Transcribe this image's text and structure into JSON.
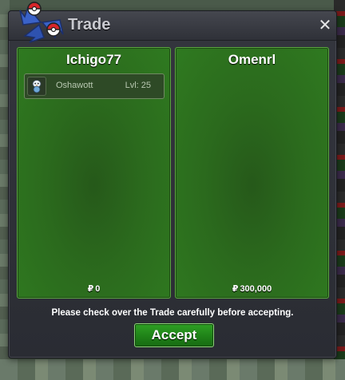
{
  "window": {
    "title": "Trade",
    "close_label": "✕"
  },
  "colors": {
    "panel_green": "#2b6a1d",
    "button_green": "#1f8218",
    "window_dark": "#2f3138"
  },
  "left_panel": {
    "trader_name": "Ichigo77",
    "currency_symbol": "₽",
    "money": "0",
    "items": [
      {
        "icon": "oshawott-sprite-icon",
        "name": "Oshawott",
        "level": "Lvl: 25"
      }
    ]
  },
  "right_panel": {
    "trader_name": "Omenrl",
    "currency_symbol": "₽",
    "money": "300,000",
    "items": []
  },
  "notice": "Please check over the Trade carefully before accepting.",
  "accept_label": "Accept"
}
